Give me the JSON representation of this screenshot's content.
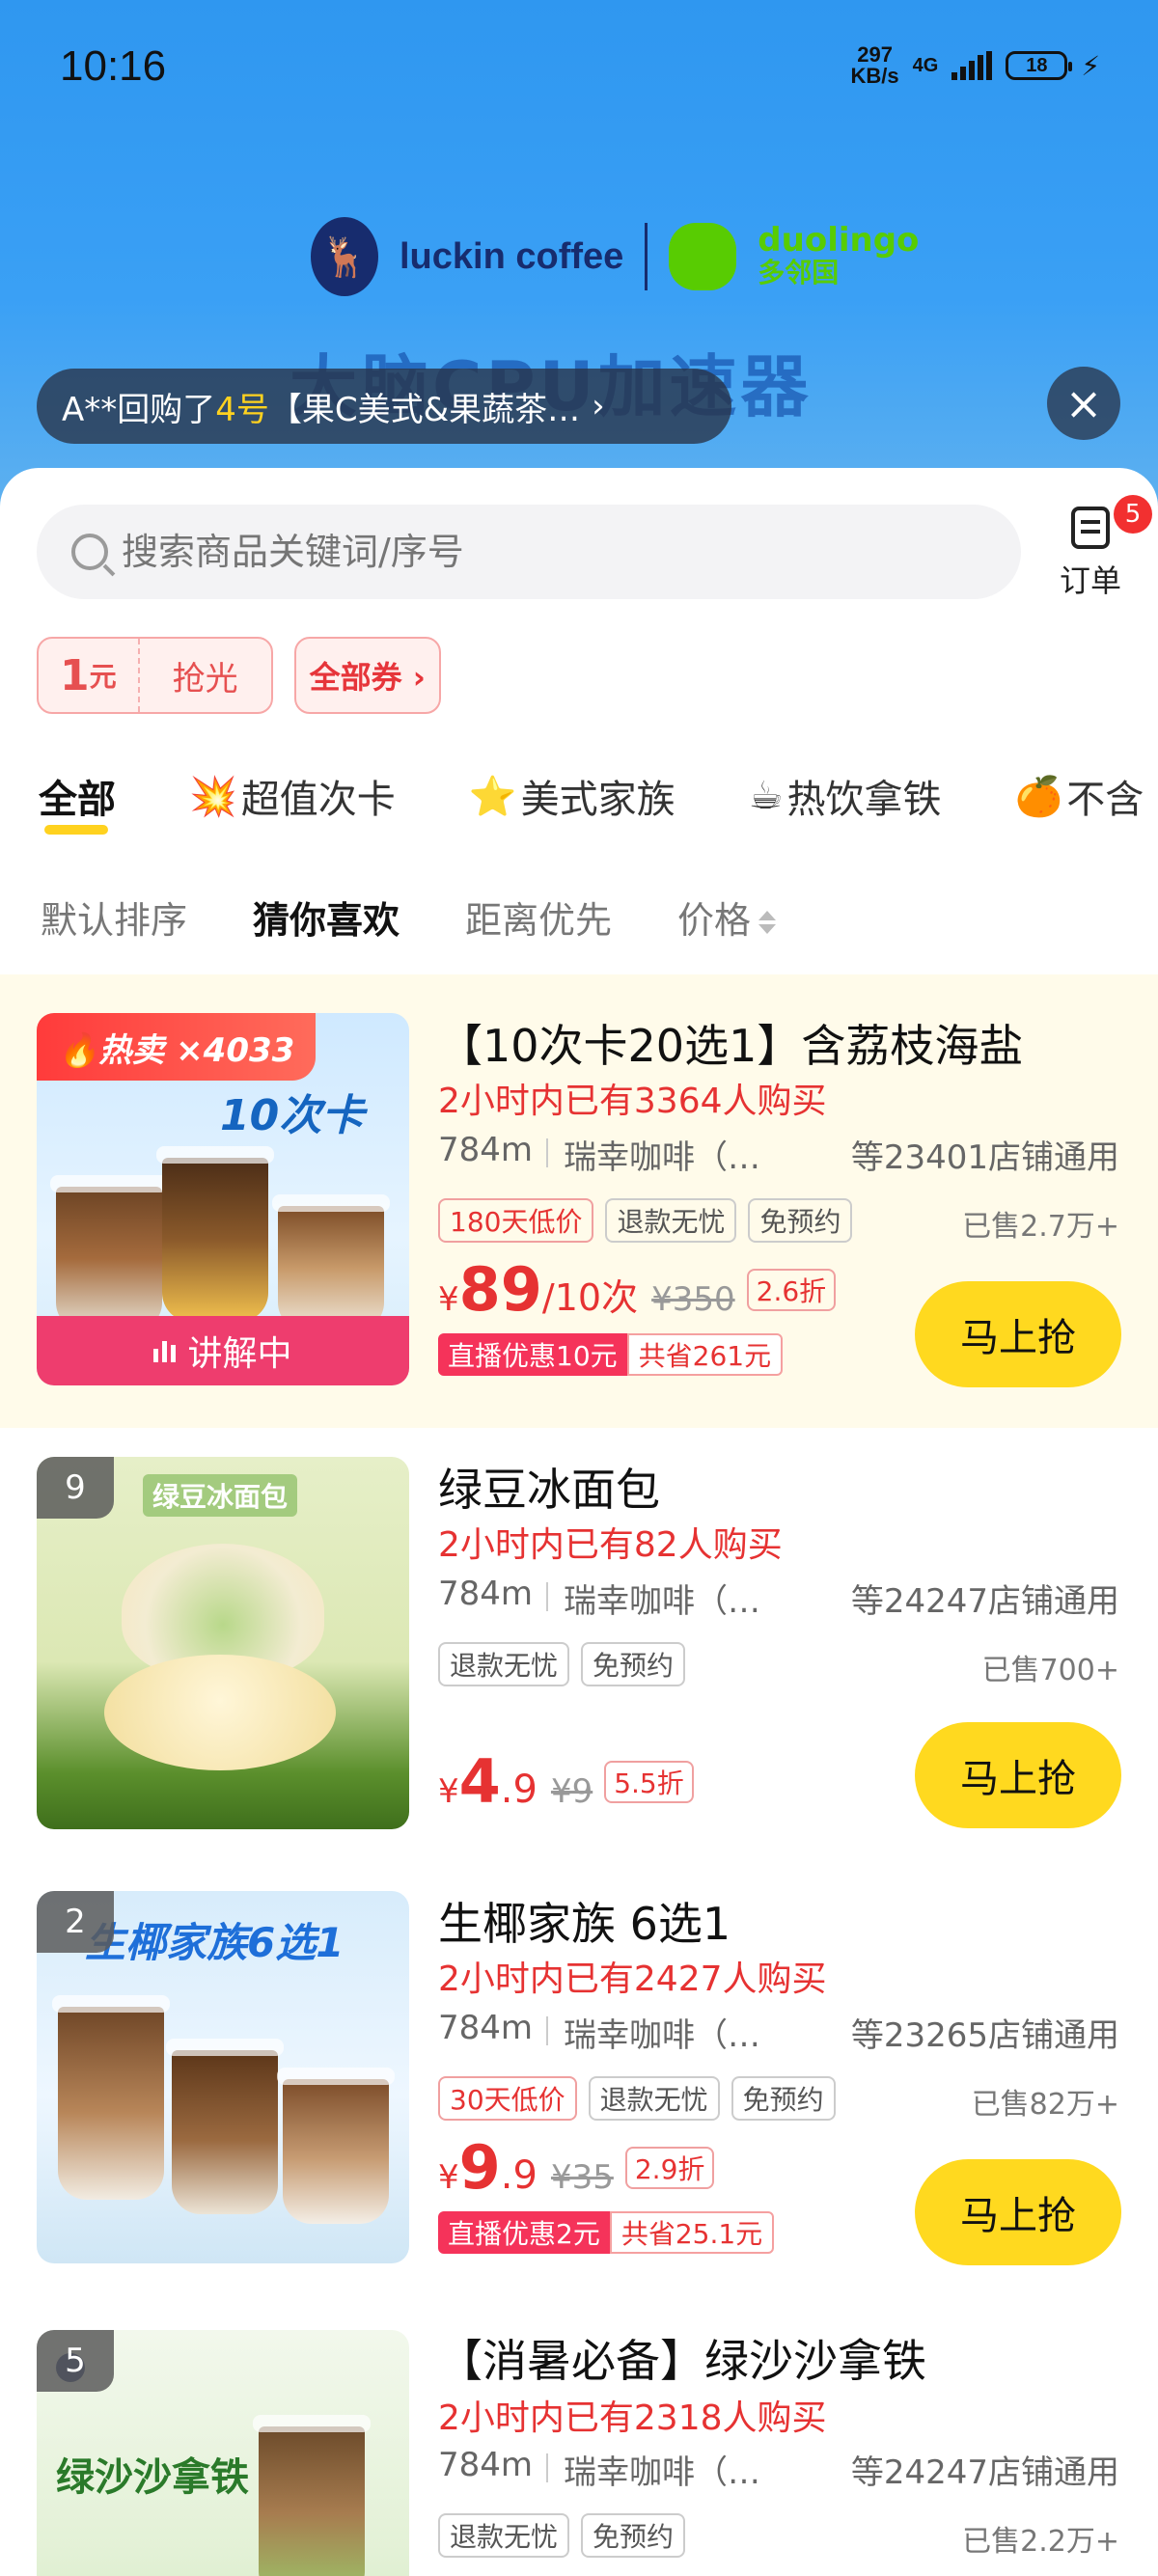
{
  "status_bar": {
    "time": "10:16",
    "net_speed_value": "297",
    "net_speed_unit": "KB/s",
    "network": "4G",
    "battery": "18"
  },
  "banner": {
    "brand_left": "luckin coffee",
    "brand_right": "duolingo",
    "brand_right_cn": "多邻国",
    "headline": "大脑CPU加速器",
    "ticker": {
      "prefix": "A**回购了",
      "highlight": "4号",
      "text": "【果C美式&果蔬茶…",
      "chevron": "›"
    },
    "close_icon": "×"
  },
  "search": {
    "placeholder": "搜索商品关键词/序号"
  },
  "orders": {
    "label": "订单",
    "badge": "5"
  },
  "coupons": {
    "first_amount": "1",
    "first_unit": "元",
    "first_action": "抢光",
    "all_label": "全部券 ›"
  },
  "category_tabs": [
    {
      "emoji": "",
      "label": "全部"
    },
    {
      "emoji": "💥",
      "label": "超值次卡"
    },
    {
      "emoji": "⭐",
      "label": "美式家族"
    },
    {
      "emoji": "☕",
      "label": "热饮拿铁"
    },
    {
      "emoji": "🍊",
      "label": "不含"
    }
  ],
  "sort_options": [
    "默认排序",
    "猜你喜欢",
    "距离优先",
    "价格"
  ],
  "products": [
    {
      "hot_label": "🔥热卖 ×4033",
      "image_overlay": "10次卡",
      "live_label": "讲解中",
      "title": "【10次卡20选1】含荔枝海盐",
      "sales": "2小时内已有3364人购买",
      "distance": "784m",
      "store": "瑞幸咖啡（…",
      "branches": "等23401店铺通用",
      "tags": [
        "180天低价",
        "退款无忧",
        "免预约"
      ],
      "sold": "已售2.7万+",
      "price_currency": "¥",
      "price_int": "89",
      "price_dec": "",
      "price_unit": "/10次",
      "orig_price": "¥350",
      "discount": "2.6折",
      "promo_a": "直播优惠10元",
      "promo_b": "共省261元",
      "buy": "马上抢"
    },
    {
      "rank": "9",
      "image_overlay": "绿豆冰面包",
      "title": "绿豆冰面包",
      "sales": "2小时内已有82人购买",
      "distance": "784m",
      "store": "瑞幸咖啡（…",
      "branches": "等24247店铺通用",
      "tags": [
        "退款无忧",
        "免预约"
      ],
      "sold": "已售700+",
      "price_currency": "¥",
      "price_int": "4",
      "price_dec": ".9",
      "orig_price": "¥9",
      "discount": "5.5折",
      "buy": "马上抢"
    },
    {
      "rank": "2",
      "image_overlay": "生椰家族6选1",
      "title": "生椰家族 6选1",
      "sales": "2小时内已有2427人购买",
      "distance": "784m",
      "store": "瑞幸咖啡（…",
      "branches": "等23265店铺通用",
      "tags": [
        "30天低价",
        "退款无忧",
        "免预约"
      ],
      "sold": "已售82万+",
      "price_currency": "¥",
      "price_int": "9",
      "price_dec": ".9",
      "orig_price": "¥35",
      "discount": "2.9折",
      "promo_a": "直播优惠2元",
      "promo_b": "共省25.1元",
      "buy": "马上抢"
    },
    {
      "rank": "5",
      "image_overlay": "绿沙沙拿铁",
      "title": "【消暑必备】绿沙沙拿铁",
      "sales": "2小时内已有2318人购买",
      "distance": "784m",
      "store": "瑞幸咖啡（…",
      "branches": "等24247店铺通用",
      "tags": [
        "退款无忧",
        "免预约"
      ],
      "sold": "已售2.2万+"
    }
  ]
}
